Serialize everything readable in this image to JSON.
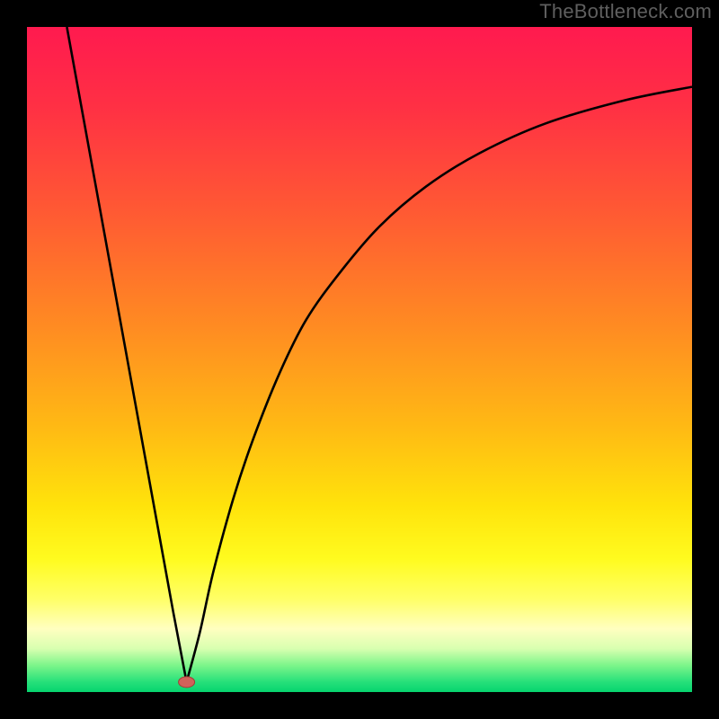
{
  "watermark": "TheBottleneck.com",
  "colors": {
    "frame": "#000000",
    "watermark": "#5f5f5f",
    "curve": "#000000",
    "marker_fill": "#d1625a",
    "marker_stroke": "#a43c36",
    "gradient_stops": [
      {
        "offset": 0.0,
        "color": "#ff1a4f"
      },
      {
        "offset": 0.12,
        "color": "#ff3044"
      },
      {
        "offset": 0.28,
        "color": "#ff5a33"
      },
      {
        "offset": 0.45,
        "color": "#ff8b22"
      },
      {
        "offset": 0.6,
        "color": "#ffb914"
      },
      {
        "offset": 0.72,
        "color": "#ffe30b"
      },
      {
        "offset": 0.8,
        "color": "#fffb1f"
      },
      {
        "offset": 0.86,
        "color": "#ffff66"
      },
      {
        "offset": 0.905,
        "color": "#ffffc0"
      },
      {
        "offset": 0.935,
        "color": "#d8ffb0"
      },
      {
        "offset": 0.96,
        "color": "#7cf58a"
      },
      {
        "offset": 0.985,
        "color": "#26e07a"
      },
      {
        "offset": 1.0,
        "color": "#06d46e"
      }
    ]
  },
  "chart_data": {
    "type": "line",
    "title": "",
    "xlabel": "",
    "ylabel": "",
    "xlim": [
      0,
      100
    ],
    "ylim": [
      0,
      100
    ],
    "marker": {
      "x": 24,
      "y": 1.5
    },
    "series": [
      {
        "name": "left-branch",
        "x": [
          6,
          10,
          14,
          18,
          22,
          24
        ],
        "y": [
          100,
          78,
          56,
          34,
          12,
          1.5
        ]
      },
      {
        "name": "right-branch",
        "x": [
          24,
          26,
          28,
          31,
          34,
          38,
          42,
          47,
          53,
          60,
          68,
          78,
          90,
          100
        ],
        "y": [
          1.5,
          9,
          18,
          29,
          38,
          48,
          56,
          63,
          70,
          76,
          81,
          85.5,
          89,
          91
        ]
      }
    ]
  }
}
